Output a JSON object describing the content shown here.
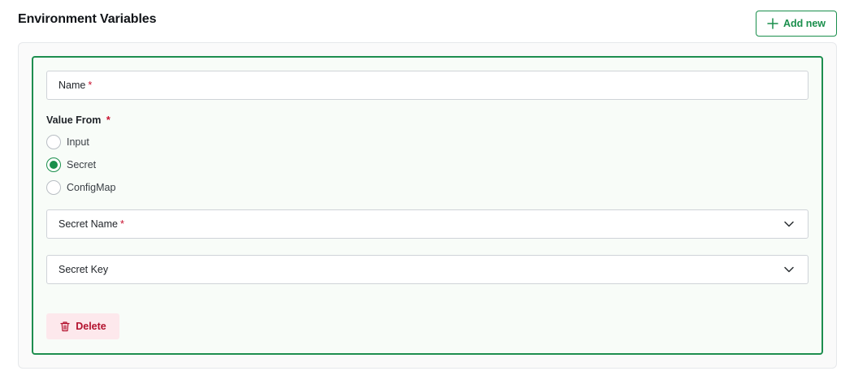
{
  "section": {
    "title": "Environment Variables",
    "add_label": "Add new"
  },
  "form": {
    "name_label": "Name",
    "required_marker": "*",
    "value_from_label": "Value From",
    "options": [
      {
        "label": "Input",
        "checked": false
      },
      {
        "label": "Secret",
        "checked": true
      },
      {
        "label": "ConfigMap",
        "checked": false
      }
    ],
    "secret_name_label": "Secret Name",
    "secret_key_label": "Secret Key",
    "delete_label": "Delete"
  },
  "colors": {
    "accent": "#1a8f4c",
    "danger": "#b3122e",
    "danger_bg": "#fde8ec",
    "required": "#c8102e"
  },
  "icons": {
    "add": "plus-icon",
    "select": "chevron-down-icon",
    "delete": "trash-icon"
  }
}
